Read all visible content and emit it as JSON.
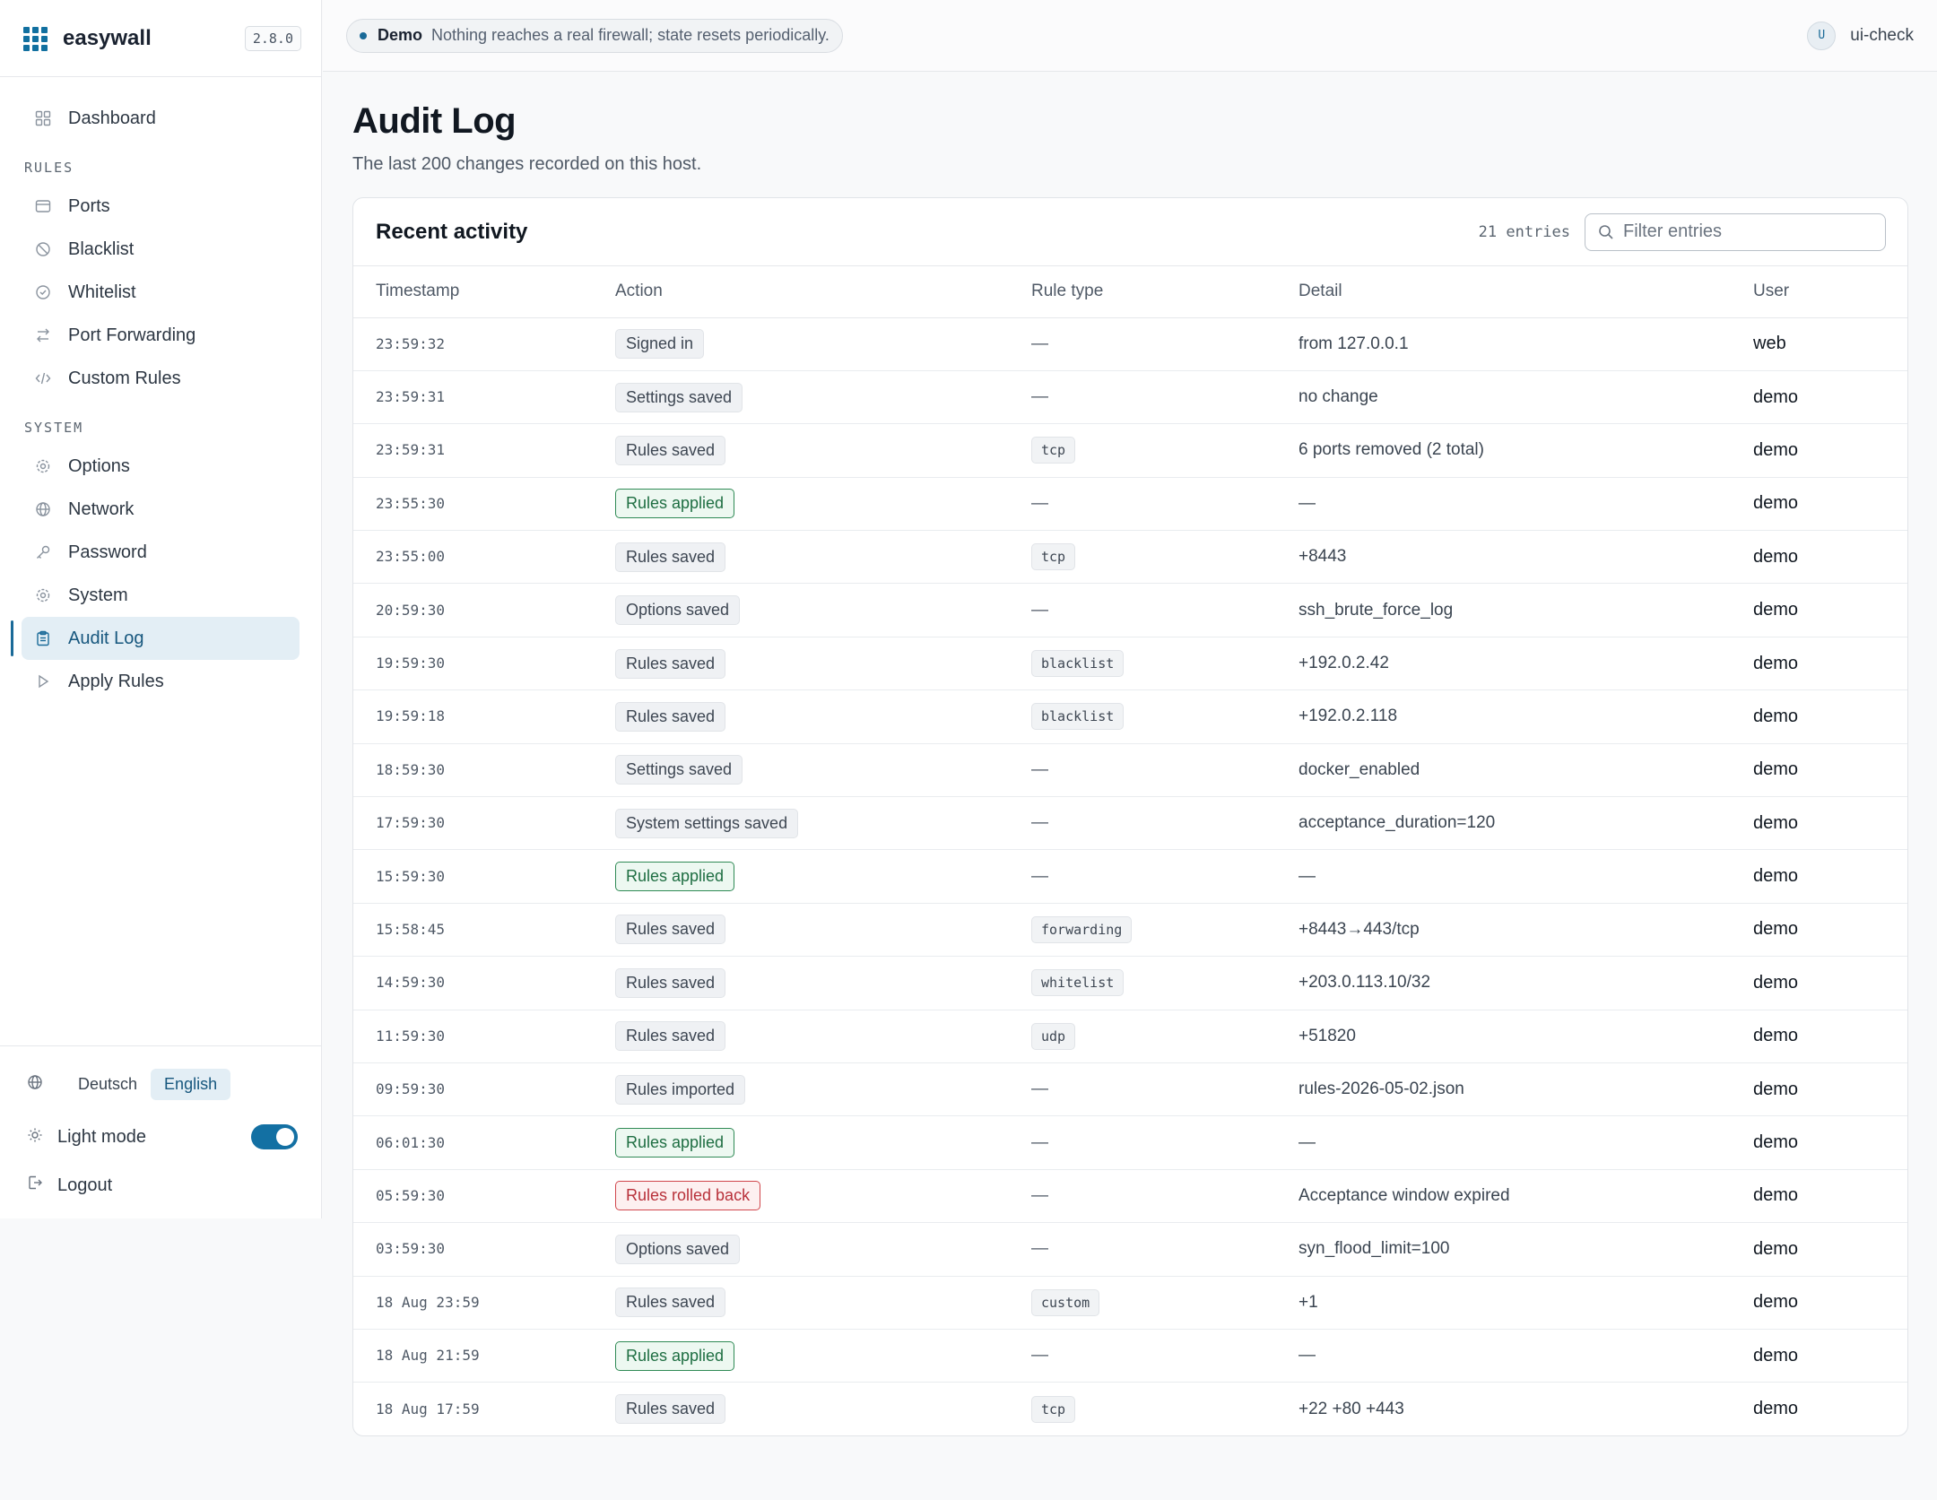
{
  "app": {
    "name": "easywall",
    "version": "2.8.0"
  },
  "sidebar": {
    "dashboard": "Dashboard",
    "rules_section": "RULES",
    "rules_items": [
      {
        "label": "Ports",
        "icon": "ports-icon"
      },
      {
        "label": "Blacklist",
        "icon": "block-icon"
      },
      {
        "label": "Whitelist",
        "icon": "check-circle-icon"
      },
      {
        "label": "Port Forwarding",
        "icon": "arrows-icon"
      },
      {
        "label": "Custom Rules",
        "icon": "code-icon"
      }
    ],
    "system_section": "SYSTEM",
    "system_items": [
      {
        "label": "Options",
        "icon": "gear-icon"
      },
      {
        "label": "Network",
        "icon": "globe-icon"
      },
      {
        "label": "Password",
        "icon": "key-icon"
      },
      {
        "label": "System",
        "icon": "gear-icon"
      },
      {
        "label": "Audit Log",
        "icon": "clipboard-icon",
        "active": true
      },
      {
        "label": "Apply Rules",
        "icon": "play-icon"
      }
    ],
    "languages": [
      "Deutsch",
      "English"
    ],
    "active_language": "English",
    "mode_label": "Light mode",
    "mode_toggle_on": true,
    "logout": "Logout"
  },
  "topbar": {
    "demo_tag": "Demo",
    "demo_text": "Nothing reaches a real firewall; state resets periodically.",
    "avatar_initial": "U",
    "username": "ui-check"
  },
  "page": {
    "title": "Audit Log",
    "subtitle": "The last 200 changes recorded on this host."
  },
  "card": {
    "title": "Recent activity",
    "entries": "21 entries",
    "filter_placeholder": "Filter entries"
  },
  "table": {
    "headers": [
      "Timestamp",
      "Action",
      "Rule type",
      "Detail",
      "User"
    ],
    "rows": [
      {
        "ts": "23:59:32",
        "action": "Signed in",
        "kind": "neutral",
        "type": "—",
        "detail": "from 127.0.0.1",
        "user": "web"
      },
      {
        "ts": "23:59:31",
        "action": "Settings saved",
        "kind": "neutral",
        "type": "—",
        "detail": "no change",
        "user": "demo"
      },
      {
        "ts": "23:59:31",
        "action": "Rules saved",
        "kind": "neutral",
        "type": "tcp",
        "detail": "6 ports removed (2 total)",
        "user": "demo"
      },
      {
        "ts": "23:55:30",
        "action": "Rules applied",
        "kind": "applied",
        "type": "—",
        "detail": "—",
        "user": "demo"
      },
      {
        "ts": "23:55:00",
        "action": "Rules saved",
        "kind": "neutral",
        "type": "tcp",
        "detail": "+8443",
        "user": "demo"
      },
      {
        "ts": "20:59:30",
        "action": "Options saved",
        "kind": "neutral",
        "type": "—",
        "detail": "ssh_brute_force_log",
        "user": "demo"
      },
      {
        "ts": "19:59:30",
        "action": "Rules saved",
        "kind": "neutral",
        "type": "blacklist",
        "detail": "+192.0.2.42",
        "user": "demo"
      },
      {
        "ts": "19:59:18",
        "action": "Rules saved",
        "kind": "neutral",
        "type": "blacklist",
        "detail": "+192.0.2.118",
        "user": "demo"
      },
      {
        "ts": "18:59:30",
        "action": "Settings saved",
        "kind": "neutral",
        "type": "—",
        "detail": "docker_enabled",
        "user": "demo"
      },
      {
        "ts": "17:59:30",
        "action": "System settings saved",
        "kind": "neutral",
        "type": "—",
        "detail": "acceptance_duration=120",
        "user": "demo"
      },
      {
        "ts": "15:59:30",
        "action": "Rules applied",
        "kind": "applied",
        "type": "—",
        "detail": "—",
        "user": "demo"
      },
      {
        "ts": "15:58:45",
        "action": "Rules saved",
        "kind": "neutral",
        "type": "forwarding",
        "detail": "+8443→443/tcp",
        "user": "demo"
      },
      {
        "ts": "14:59:30",
        "action": "Rules saved",
        "kind": "neutral",
        "type": "whitelist",
        "detail": "+203.0.113.10/32",
        "user": "demo"
      },
      {
        "ts": "11:59:30",
        "action": "Rules saved",
        "kind": "neutral",
        "type": "udp",
        "detail": "+51820",
        "user": "demo"
      },
      {
        "ts": "09:59:30",
        "action": "Rules imported",
        "kind": "neutral",
        "type": "—",
        "detail": "rules-2026-05-02.json",
        "user": "demo"
      },
      {
        "ts": "06:01:30",
        "action": "Rules applied",
        "kind": "applied",
        "type": "—",
        "detail": "—",
        "user": "demo"
      },
      {
        "ts": "05:59:30",
        "action": "Rules rolled back",
        "kind": "rolled",
        "type": "—",
        "detail": "Acceptance window expired",
        "user": "demo"
      },
      {
        "ts": "03:59:30",
        "action": "Options saved",
        "kind": "neutral",
        "type": "—",
        "detail": "syn_flood_limit=100",
        "user": "demo"
      },
      {
        "ts": "18 Aug 23:59",
        "action": "Rules saved",
        "kind": "neutral",
        "type": "custom",
        "detail": "+1",
        "user": "demo"
      },
      {
        "ts": "18 Aug 21:59",
        "action": "Rules applied",
        "kind": "applied",
        "type": "—",
        "detail": "—",
        "user": "demo"
      },
      {
        "ts": "18 Aug 17:59",
        "action": "Rules saved",
        "kind": "neutral",
        "type": "tcp",
        "detail": "+22 +80 +443",
        "user": "demo"
      }
    ]
  },
  "colors": {
    "accent": "#1a6a98",
    "applied": "#2f8a55",
    "rolled_back": "#d0464c"
  }
}
